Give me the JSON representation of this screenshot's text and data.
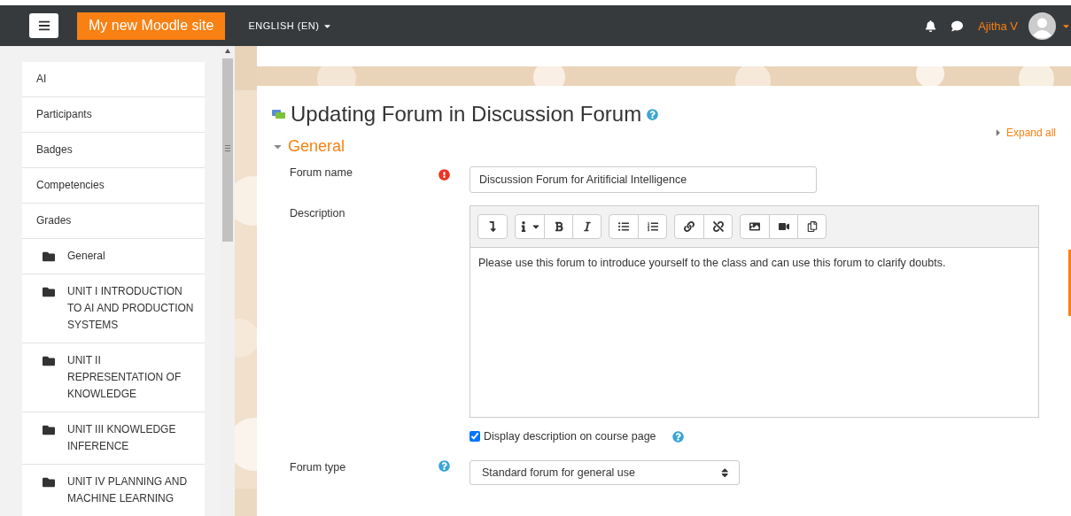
{
  "navbar": {
    "brand": "My new Moodle site",
    "language": "ENGLISH (EN)",
    "user_name": "Ajitha V"
  },
  "sidebar": {
    "items": [
      {
        "label": "AI",
        "kind": "link"
      },
      {
        "label": "Participants",
        "kind": "link"
      },
      {
        "label": "Badges",
        "kind": "link"
      },
      {
        "label": "Competencies",
        "kind": "link"
      },
      {
        "label": "Grades",
        "kind": "link"
      },
      {
        "label": "General",
        "kind": "section"
      },
      {
        "label": "UNIT I INTRODUCTION TO AI AND PRODUCTION SYSTEMS",
        "kind": "section"
      },
      {
        "label": "UNIT II REPRESENTATION OF KNOWLEDGE",
        "kind": "section"
      },
      {
        "label": "UNIT III KNOWLEDGE INFERENCE",
        "kind": "section"
      },
      {
        "label": "UNIT IV PLANNING AND MACHINE LEARNING",
        "kind": "section"
      }
    ]
  },
  "page": {
    "title": "Updating Forum in Discussion Forum",
    "expand_all": "Expand all",
    "section": {
      "title": "General",
      "expanded": true
    },
    "fields": [
      {
        "kind": "text",
        "label": "Forum name",
        "required": true,
        "value": "Discussion Forum for Aritificial Intelligence"
      },
      {
        "kind": "editor",
        "label": "Description",
        "value": "Please use this forum to introduce yourself to the class and can use this forum to clarify doubts."
      },
      {
        "kind": "checkbox",
        "label": "Display description on course page",
        "help": true,
        "checked": true
      },
      {
        "kind": "select",
        "label": "Forum type",
        "help": true,
        "value": "Standard forum for general use"
      }
    ]
  }
}
